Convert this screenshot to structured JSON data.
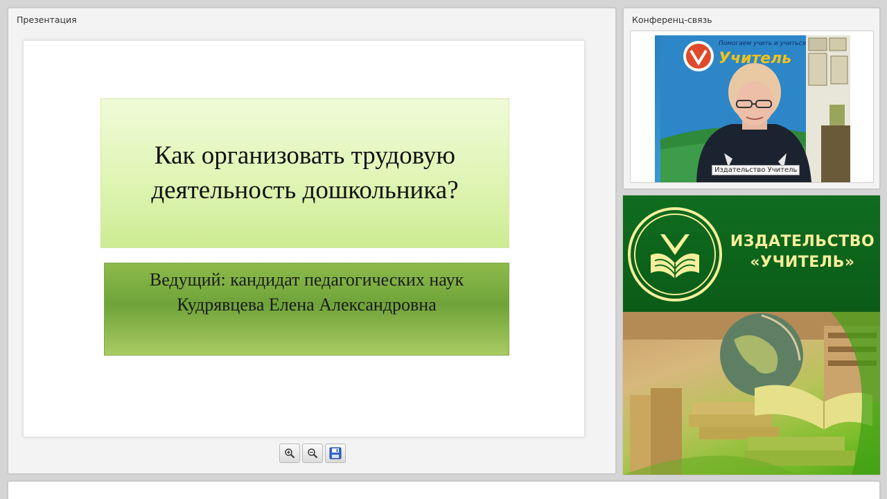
{
  "presentation": {
    "panel_title": "Презентация",
    "slide": {
      "title": "Как организовать трудовую\nдеятельность дошкольника?",
      "presenter": "Ведущий: кандидат педагогических наук\nКудрявцева Елена Александровна"
    },
    "toolbar": {
      "zoom_in_icon": "zoom-in-icon",
      "zoom_out_icon": "zoom-out-icon",
      "save_icon": "save-icon"
    }
  },
  "conference": {
    "panel_title": "Конференц-связь",
    "video_label": "Издательство Учитель",
    "backdrop_slogan": "Помогаем учить и учиться",
    "backdrop_brand": "Учитель"
  },
  "publisher": {
    "name": "ИЗДАТЕЛЬСТВО\n«УЧИТЕЛЬ»"
  },
  "colors": {
    "publisher_green": "#0f6a1e",
    "publisher_text": "#f6ef9c",
    "slide_title_bg": "#dff5b4",
    "slide_presenter_bg": "#7fae41"
  }
}
